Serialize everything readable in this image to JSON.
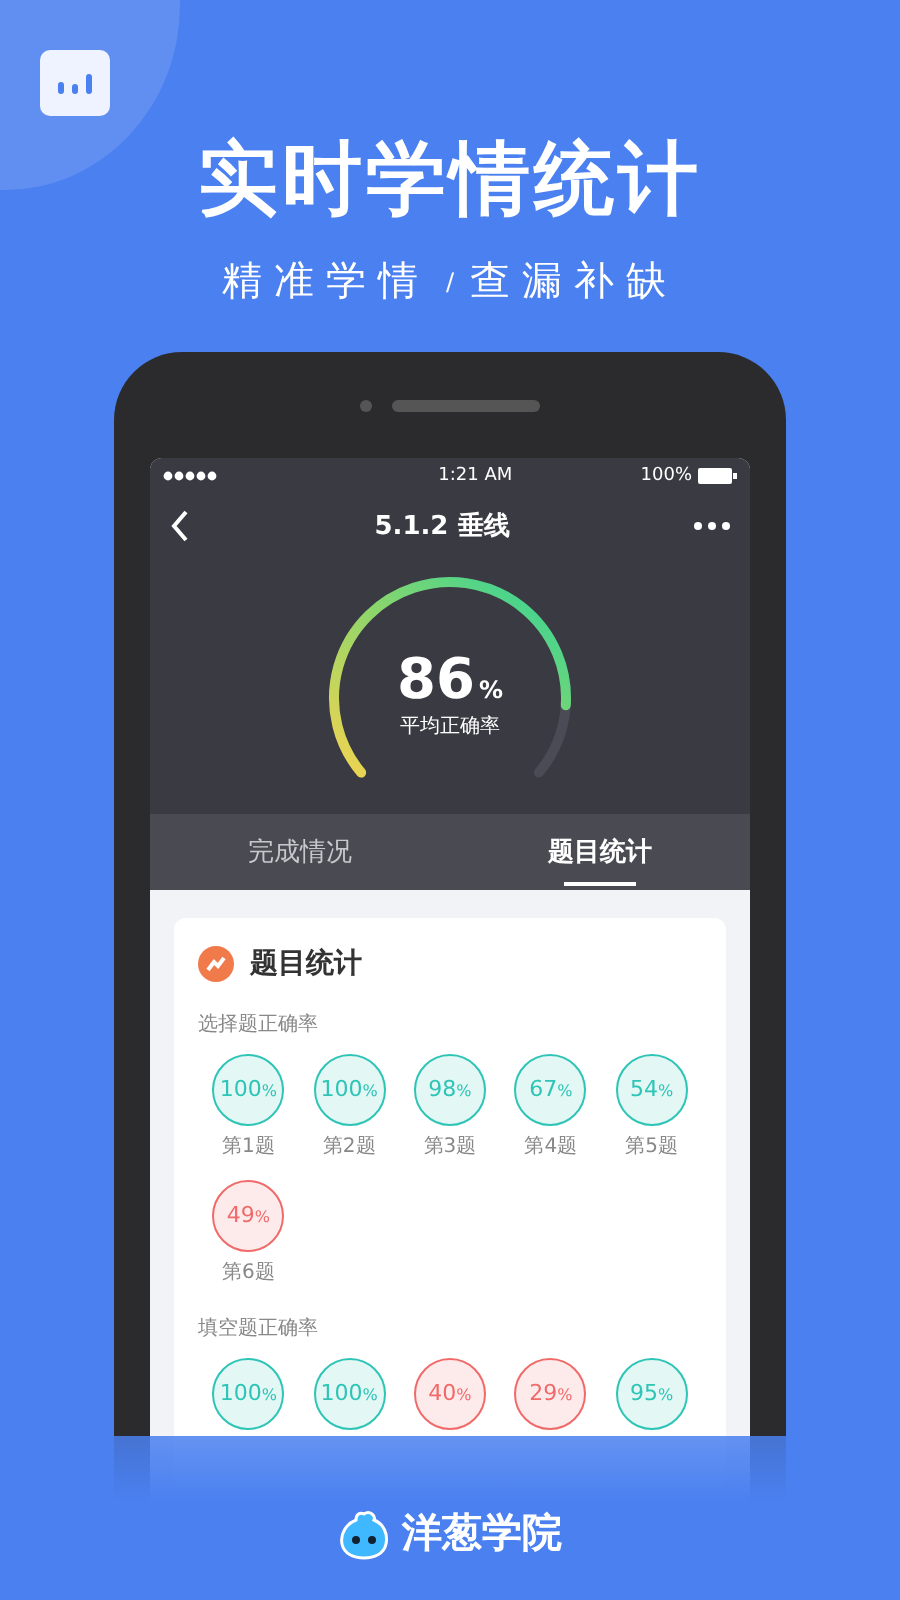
{
  "headline": "实时学情统计",
  "tagline": {
    "left": "精准学情",
    "separator": "/",
    "right": "查漏补缺"
  },
  "phone": {
    "status_bar": {
      "time": "1:21 AM",
      "battery": "100%"
    },
    "nav": {
      "title": "5.1.2 垂线"
    },
    "gauge": {
      "value": "86",
      "unit": "%",
      "label": "平均正确率"
    },
    "tabs": [
      {
        "label": "完成情况",
        "selected": false
      },
      {
        "label": "题目统计",
        "selected": true
      }
    ],
    "card": {
      "title": "题目统计",
      "sections": [
        {
          "label": "选择题正确率",
          "items": [
            {
              "value": "100",
              "unit": "%",
              "label": "第1题",
              "color": "#2ec4b6"
            },
            {
              "value": "100",
              "unit": "%",
              "label": "第2题",
              "color": "#2ec4b6"
            },
            {
              "value": "98",
              "unit": "%",
              "label": "第3题",
              "color": "#2ec4b6"
            },
            {
              "value": "67",
              "unit": "%",
              "label": "第4题",
              "color": "#2ec4b6"
            },
            {
              "value": "54",
              "unit": "%",
              "label": "第5题",
              "color": "#2ec4b6"
            },
            {
              "value": "49",
              "unit": "%",
              "label": "第6题",
              "color": "#f06a6a"
            }
          ]
        },
        {
          "label": "填空题正确率",
          "items": [
            {
              "value": "100",
              "unit": "%",
              "color": "#2ec4b6"
            },
            {
              "value": "100",
              "unit": "%",
              "color": "#2ec4b6"
            },
            {
              "value": "40",
              "unit": "%",
              "color": "#f06a6a"
            },
            {
              "value": "29",
              "unit": "%",
              "color": "#f06a6a"
            },
            {
              "value": "95",
              "unit": "%",
              "color": "#2ec4b6"
            }
          ]
        }
      ]
    }
  },
  "brand": "洋葱学院"
}
